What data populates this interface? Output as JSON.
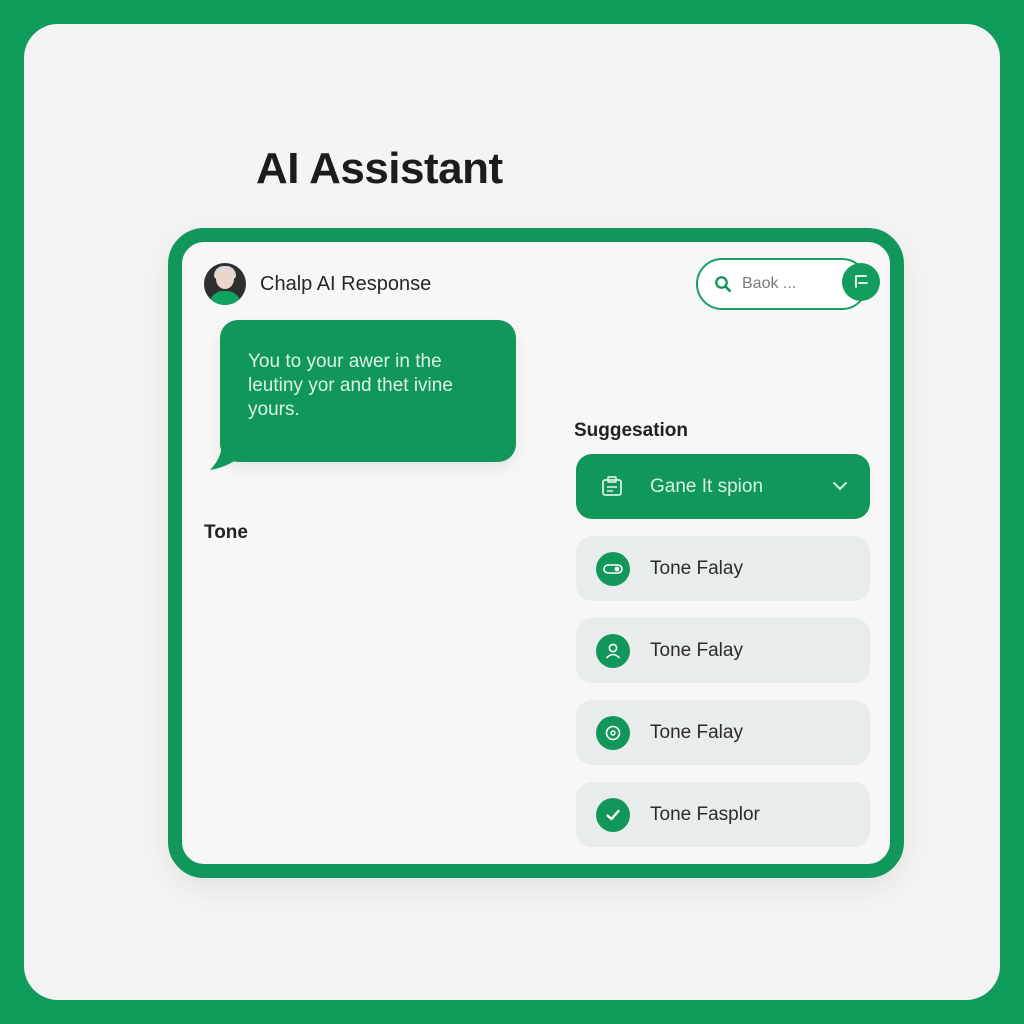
{
  "app": {
    "title": "AI Assistant"
  },
  "header": {
    "title": "Chalp AI Response"
  },
  "search": {
    "placeholder": "Baok ..."
  },
  "message": {
    "text": "You to your awer in the leutiny yor and thet ivine yours."
  },
  "tone": {
    "label": "Tone"
  },
  "suggestions": {
    "title": "Suggesation",
    "items": [
      {
        "label": "Gane It spion",
        "icon": "clipboard-icon",
        "active": true
      },
      {
        "label": "Tone Falay",
        "icon": "toggle-icon"
      },
      {
        "label": "Tone Falay",
        "icon": "user-icon"
      },
      {
        "label": "Tone Falay",
        "icon": "info-circle-icon"
      },
      {
        "label": "Tone Fasplor",
        "icon": "check-icon"
      }
    ]
  },
  "colors": {
    "accent": "#12975a",
    "background": "#f4f4f4",
    "frame": "#0e9c5a"
  }
}
